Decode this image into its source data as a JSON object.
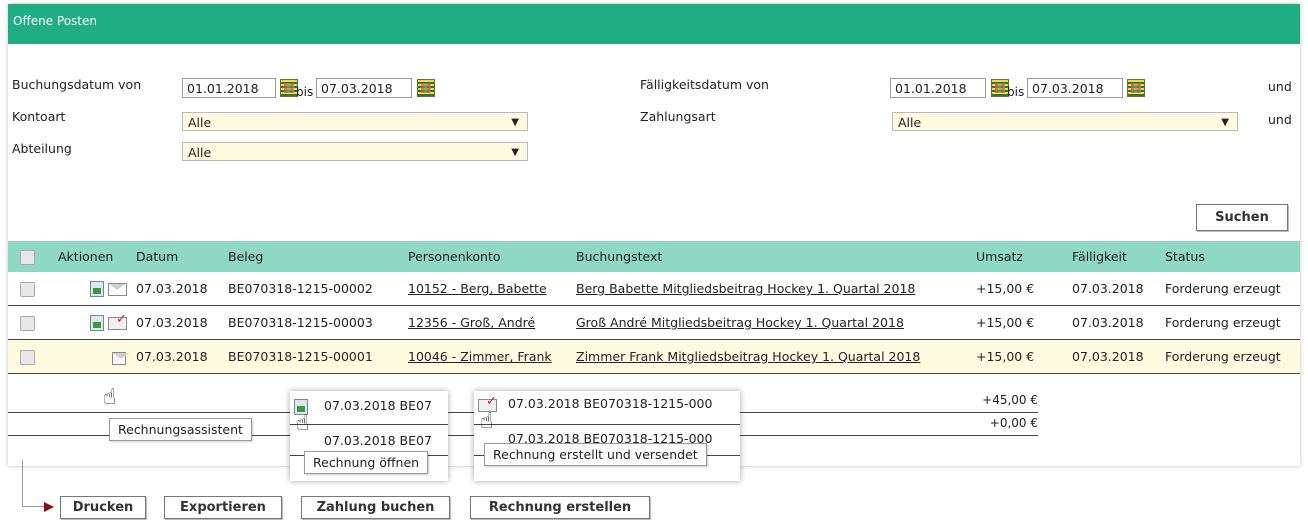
{
  "panel": {
    "title": "Offene Posten"
  },
  "filters": {
    "buchungsdatum_label": "Buchungsdatum von",
    "buchungsdatum_from": "01.01.2018",
    "bis1": "bis",
    "buchungsdatum_to": "07.03.2018",
    "kontoart_label": "Kontoart",
    "kontoart_value": "Alle",
    "abteilung_label": "Abteilung",
    "abteilung_value": "Alle",
    "faelligkeit_label": "Fälligkeitsdatum von",
    "faelligkeit_from": "01.01.2018",
    "bis2": "bis",
    "faelligkeit_to": "07.03.2018",
    "zahlungsart_label": "Zahlungsart",
    "zahlungsart_value": "Alle",
    "und1": "und",
    "und2": "und",
    "search_button": "Suchen"
  },
  "table": {
    "headers": [
      "Aktionen",
      "Datum",
      "Beleg",
      "Personenkonto",
      "Buchungstext",
      "Umsatz",
      "Fälligkeit",
      "Status"
    ],
    "rows": [
      {
        "datum": "07.03.2018",
        "beleg": "BE070318-1215-00002",
        "konto": "10152 - Berg, Babette",
        "text": "Berg Babette Mitgliedsbeitrag Hockey 1. Quartal 2018",
        "umsatz": "+15,00 €",
        "faellig": "07.03.2018",
        "status": "Forderung erzeugt"
      },
      {
        "datum": "07.03.2018",
        "beleg": "BE070318-1215-00003",
        "konto": "12356 - Groß, André",
        "text": "Groß André Mitgliedsbeitrag Hockey 1. Quartal 2018",
        "umsatz": "+15,00 €",
        "faellig": "07.03.2018",
        "status": "Forderung erzeugt"
      },
      {
        "datum": "07.03.2018",
        "beleg": "BE070318-1215-00001",
        "konto": "10046 - Zimmer, Frank",
        "text": "Zimmer Frank Mitgliedsbeitrag Hockey 1. Quartal 2018",
        "umsatz": "+15,00 €",
        "faellig": "07.03.2018",
        "status": "Forderung erzeugt"
      }
    ],
    "sum1": "+45,00 €",
    "sum2": "+0,00 €"
  },
  "popups": {
    "p1_row1": "07.03.2018   BE07",
    "p1_row2": "07.03.2018   BE07",
    "p2_row1": "07.03.2018   BE070318-1215-000",
    "p2_row2": "07.03.2018   BE070318-1215-000"
  },
  "tooltips": {
    "rechnungsassistent": "Rechnungsassistent",
    "rechnung_oeffnen": "Rechnung öffnen",
    "rechnung_versendet": "Rechnung erstellt und versendet"
  },
  "bottom_buttons": {
    "drucken": "Drucken",
    "exportieren": "Exportieren",
    "zahlung_buchen": "Zahlung buchen",
    "rechnung_erstellen": "Rechnung erstellen"
  }
}
